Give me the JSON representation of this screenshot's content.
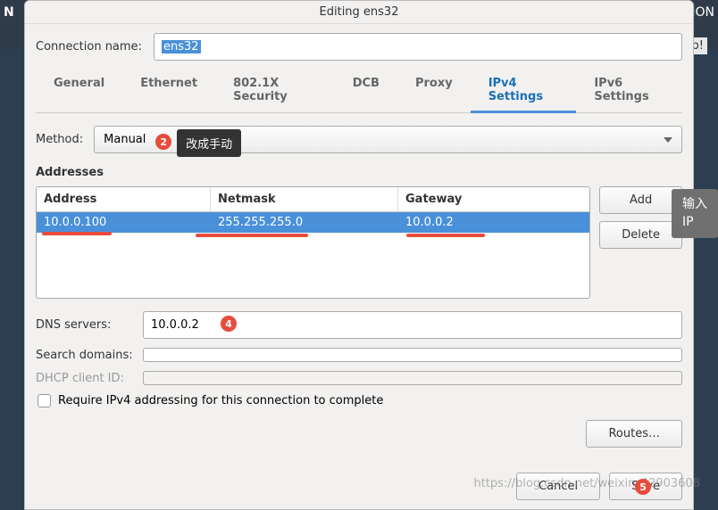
{
  "backdrop": {
    "left": "N",
    "right": "TION",
    "help": "lp!"
  },
  "dialog": {
    "title": "Editing ens32",
    "conn_label": "Connection name:",
    "conn_value": "ens32"
  },
  "tabs": [
    "General",
    "Ethernet",
    "802.1X Security",
    "DCB",
    "Proxy",
    "IPv4 Settings",
    "IPv6 Settings"
  ],
  "method": {
    "label": "Method:",
    "value": "Manual"
  },
  "addresses": {
    "title": "Addresses",
    "headers": [
      "Address",
      "Netmask",
      "Gateway"
    ],
    "rows": [
      {
        "address": "10.0.0.100",
        "netmask": "255.255.255.0",
        "gateway": "10.0.0.2"
      }
    ],
    "add": "Add",
    "delete": "Delete"
  },
  "fields": {
    "dns_label": "DNS servers:",
    "dns_value": "10.0.0.2",
    "search_label": "Search domains:",
    "search_value": "",
    "dhcp_label": "DHCP client ID:",
    "dhcp_value": ""
  },
  "checkbox": {
    "label": "Require IPv4 addressing for this connection to complete"
  },
  "routes": "Routes…",
  "footer": {
    "cancel": "Cancel",
    "save": "Save"
  },
  "annotations": {
    "tip_method": "改成手动",
    "tip_ip": "输入\nIP"
  },
  "watermark": "https://blog.csdn.net/weixin_42903608"
}
